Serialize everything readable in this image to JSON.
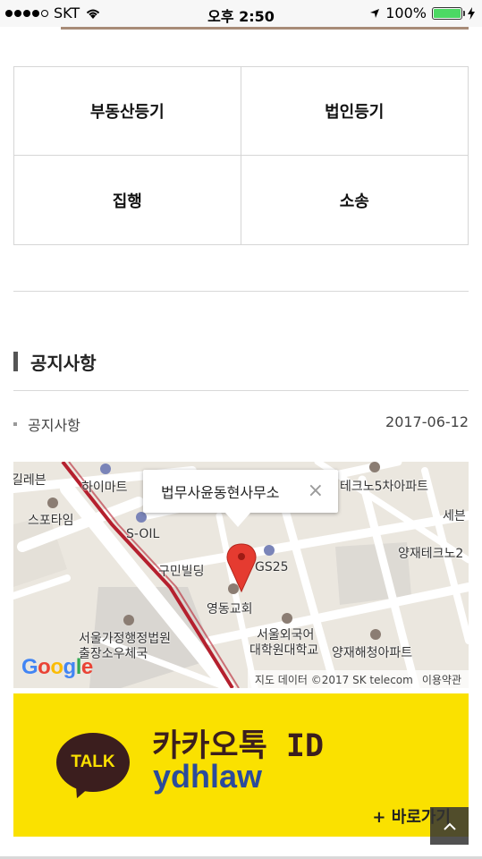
{
  "status_bar": {
    "carrier": "SKT",
    "time": "오후 2:50",
    "battery": "100%",
    "battery_level": 1.0
  },
  "categories": [
    {
      "label": "부동산등기"
    },
    {
      "label": "법인등기"
    },
    {
      "label": "집행"
    },
    {
      "label": "소송"
    }
  ],
  "notice": {
    "section_title": "공지사항",
    "items": [
      {
        "title": "공지사항",
        "date": "2017-06-12"
      }
    ]
  },
  "map": {
    "popup_title": "법무사윤동현사무소",
    "close_symbol": "×",
    "labels": {
      "l1": "길레븐",
      "l2": "하이마트",
      "l3": "스포타임",
      "l4": "S-OIL",
      "l5": "구민빌딩",
      "l6": "GS25",
      "l7": "영동교회",
      "l8": "서울가정행정법원",
      "l9": "출장소우체국",
      "l10": "서울외국어",
      "l11": "대학원대학교",
      "l12": "양재해청아파트",
      "l13": "테크노5차아파트",
      "l14": "세븐",
      "l15": "양재테크노2"
    },
    "google_logo": "Google",
    "attribution": "지도 데이터 ©2017 SK telecom",
    "terms": "이용약관"
  },
  "kakao": {
    "bubble_text": "TALK",
    "line1": "카카오톡 ID",
    "line2": "ydhlaw",
    "goto": "+ 바로가기"
  },
  "colors": {
    "kakao_yellow": "#fae100",
    "kakao_brown": "#3b1e1e",
    "id_blue": "#2b4b9b",
    "map_marker": "#e53b30",
    "rail_line": "#b5202e"
  }
}
